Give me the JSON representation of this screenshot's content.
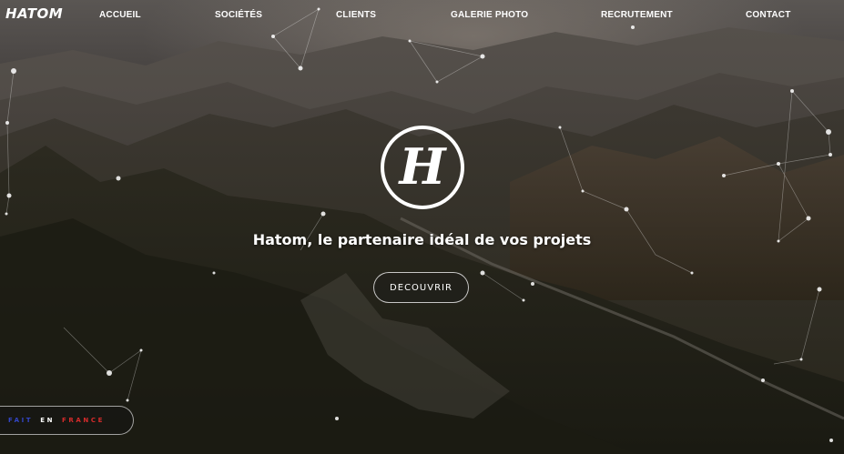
{
  "brand": {
    "name": "HATOM"
  },
  "nav": {
    "items": [
      {
        "label": "ACCUEIL"
      },
      {
        "label": "SOCIÉTÉS"
      },
      {
        "label": "CLIENTS"
      },
      {
        "label": "GALERIE PHOTO"
      },
      {
        "label": "RECRUTEMENT"
      },
      {
        "label": "CONTACT"
      }
    ]
  },
  "hero": {
    "emblem_letter": "H",
    "tagline": "Hatom, le partenaire idéal de vos projets",
    "cta_label": "DECOUVRIR"
  },
  "badge": {
    "word1": "FAIT",
    "word2": "EN",
    "word3": "FRANCE",
    "colors": {
      "word1": "#3346c8",
      "word2": "#ffffff",
      "word3": "#d52b2b"
    }
  },
  "colors": {
    "text": "#ffffff",
    "sky": "#5a5653",
    "forest": "#1d1c16"
  }
}
